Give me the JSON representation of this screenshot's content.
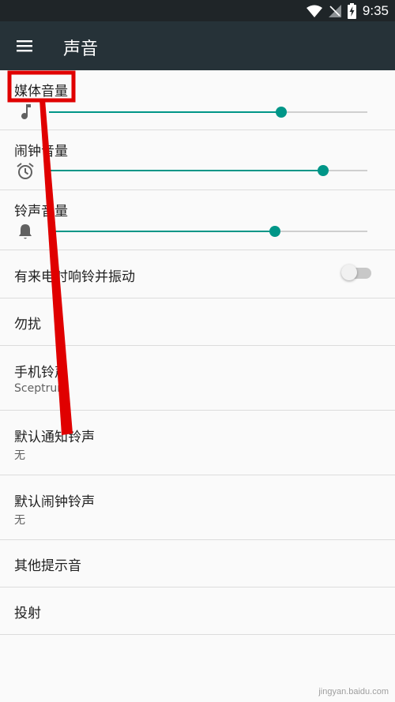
{
  "status_bar": {
    "time": "9:35",
    "icons": [
      "wifi-icon",
      "no-signal-icon",
      "battery-charging-icon"
    ]
  },
  "toolbar": {
    "title": "声音",
    "menu_icon": "menu-icon"
  },
  "settings": {
    "media_volume": {
      "label": "媒体音量",
      "icon": "music-note-icon",
      "level": 0.73
    },
    "alarm_volume": {
      "label": "闹钟音量",
      "icon": "alarm-clock-icon",
      "level": 0.86
    },
    "ring_volume": {
      "label": "铃声音量",
      "icon": "bell-icon",
      "level": 0.71
    },
    "vibrate_on_ring": {
      "label": "有来电时响铃并振动",
      "enabled": false
    },
    "do_not_disturb": {
      "label": "勿扰"
    },
    "phone_ringtone": {
      "label": "手机铃声",
      "value": "Sceptrum"
    },
    "default_notification": {
      "label": "默认通知铃声",
      "value": "无"
    },
    "default_alarm": {
      "label": "默认闹钟铃声",
      "value": "无"
    },
    "other_sounds": {
      "label": "其他提示音"
    },
    "cast": {
      "label": "投射"
    }
  },
  "annotation_color": "#e00000",
  "accent_color": "#009688",
  "watermark": {
    "text": "jingyan.baidu.com"
  }
}
